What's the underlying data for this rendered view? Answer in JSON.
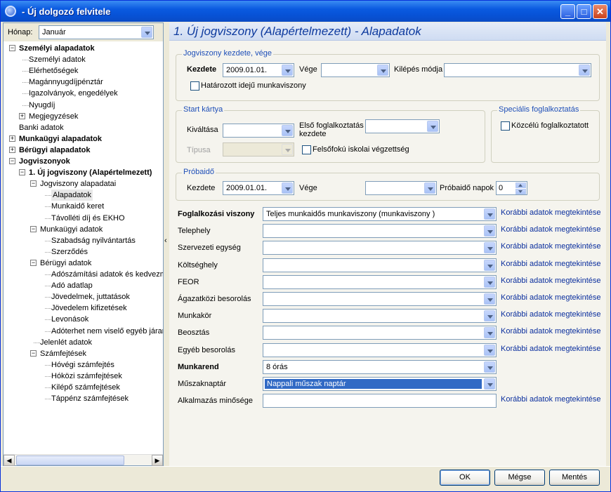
{
  "window": {
    "title": "- Új dolgozó felvitele"
  },
  "left": {
    "honap_label": "Hónap:",
    "honap_value": "Január",
    "tree": [
      {
        "label": "Személyi alapadatok",
        "bold": true,
        "level": 0,
        "exp": "-"
      },
      {
        "label": "Személyi adatok",
        "level": 1
      },
      {
        "label": "Elérhetőségek",
        "level": 1
      },
      {
        "label": "Magánnyugdíjpénztár",
        "level": 1
      },
      {
        "label": "Igazolványok, engedélyek",
        "level": 1
      },
      {
        "label": "Nyugdíj",
        "level": 1
      },
      {
        "label": "Megjegyzések",
        "level": 1,
        "exp": "+"
      },
      {
        "label": "Banki adatok",
        "level": 0
      },
      {
        "label": "Munkaügyi alapadatok",
        "bold": true,
        "level": 0,
        "exp": "+"
      },
      {
        "label": "Bérügyi alapadatok",
        "bold": true,
        "level": 0,
        "exp": "+"
      },
      {
        "label": "Jogviszonyok",
        "bold": true,
        "level": 0,
        "exp": "-"
      },
      {
        "label": "1. Új jogviszony (Alapértelmezett)",
        "bold": true,
        "level": 1,
        "exp": "-"
      },
      {
        "label": "Jogviszony alapadatai",
        "level": 2,
        "exp": "-"
      },
      {
        "label": "Alapadatok",
        "level": 3,
        "sel": true
      },
      {
        "label": "Munkaidő keret",
        "level": 3
      },
      {
        "label": "Távolléti díj és EKHO",
        "level": 3
      },
      {
        "label": "Munkaügyi adatok",
        "level": 2,
        "exp": "-"
      },
      {
        "label": "Szabadság nyilvántartás",
        "level": 3
      },
      {
        "label": "Szerződés",
        "level": 3
      },
      {
        "label": "Bérügyi adatok",
        "level": 2,
        "exp": "-"
      },
      {
        "label": "Adószámítási adatok és kedvezmények",
        "level": 3
      },
      {
        "label": "Adó adatlap",
        "level": 3
      },
      {
        "label": "Jövedelmek, juttatások",
        "level": 3
      },
      {
        "label": "Jövedelem kifizetések",
        "level": 3
      },
      {
        "label": "Levonások",
        "level": 3
      },
      {
        "label": "Adóterhet nem viselő egyéb járandóságok",
        "level": 3
      },
      {
        "label": "Jelenlét adatok",
        "level": 2
      },
      {
        "label": "Számfejtések",
        "level": 2,
        "exp": "-"
      },
      {
        "label": "Hóvégi számfejtés",
        "level": 3
      },
      {
        "label": "Hóközi számfejtések",
        "level": 3
      },
      {
        "label": "Kilépő számfejtések",
        "level": 3
      },
      {
        "label": "Táppénz számfejtések",
        "level": 3
      }
    ]
  },
  "right": {
    "header": "1. Új jogviszony (Alapértelmezett) - Alapadatok",
    "jogviszony": {
      "legend": "Jogviszony kezdete, vége",
      "kezdete_label": "Kezdete",
      "kezdete_value": "2009.01.01.",
      "vege_label": "Vége",
      "kilepes_label": "Kilépés módja",
      "hatarozott_label": "Határozott idejű munkaviszony"
    },
    "start": {
      "legend": "Start kártya",
      "kivaltasa_label": "Kiváltása",
      "elso_label_1": "Első foglalkoztatás",
      "elso_label_2": "kezdete",
      "tipusa_label": "Típusa",
      "felsofoku_label": "Felsőfokú iskolai végzettség"
    },
    "specialis": {
      "legend": "Speciális foglalkoztatás",
      "kozcelu_label": "Közcélú foglalkoztatott"
    },
    "probaido": {
      "legend": "Próbaidő",
      "kezdete_label": "Kezdete",
      "kezdete_value": "2009.01.01.",
      "vege_label": "Vége",
      "napok_label": "Próbaidő napok",
      "napok_value": "0"
    },
    "link_text": "Korábbi adatok megtekintése",
    "rows": [
      {
        "label": "Foglalkozási viszony",
        "bold": true,
        "value": "Teljes munkaidős munkaviszony (munkaviszony )",
        "link": true
      },
      {
        "label": "Telephely",
        "value": "",
        "link": true
      },
      {
        "label": "Szervezeti egység",
        "value": "",
        "link": true
      },
      {
        "label": "Költséghely",
        "value": "",
        "link": true
      },
      {
        "label": "FEOR",
        "value": "",
        "link": true
      },
      {
        "label": "Ágazatközi besorolás",
        "value": "",
        "link": true
      },
      {
        "label": "Munkakör",
        "value": "",
        "link": true
      },
      {
        "label": "Beosztás",
        "value": "",
        "link": true
      },
      {
        "label": "Egyéb besorolás",
        "value": "",
        "link": true
      },
      {
        "label": "Munkarend",
        "bold": true,
        "value": "8 órás",
        "link": false
      },
      {
        "label": "Műszaknaptár",
        "value": "Nappali műszak naptár",
        "link": false,
        "selected": true
      },
      {
        "label": "Alkalmazás minősége",
        "value": "",
        "link": true,
        "textbox": true
      }
    ]
  },
  "buttons": {
    "ok": "OK",
    "megse": "Mégse",
    "mentes": "Mentés"
  }
}
